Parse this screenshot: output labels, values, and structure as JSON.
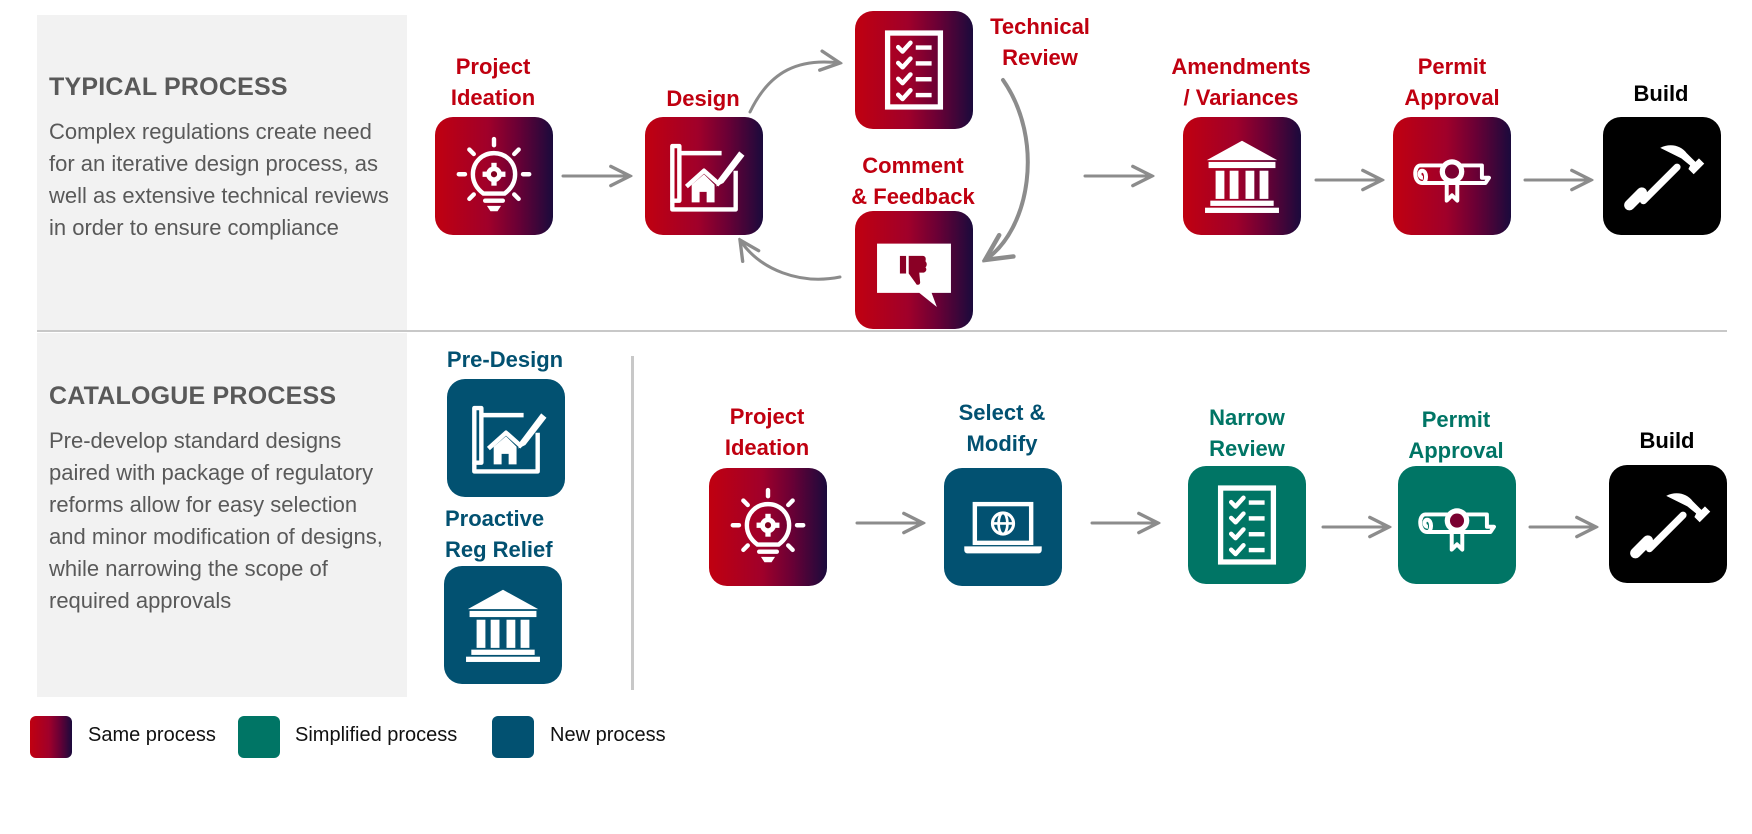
{
  "typical": {
    "title": "TYPICAL PROCESS",
    "description": "Complex regulations create need for an iterative design process, as well as extensive technical reviews in order to ensure compliance",
    "steps": [
      {
        "label_1": "Project",
        "label_2": "Ideation",
        "icon": "lightbulb-gear-icon",
        "category": "same"
      },
      {
        "label_1": "Design",
        "icon": "blueprint-house-icon",
        "category": "same"
      },
      {
        "label_1": "Technical",
        "label_2": "Review",
        "icon": "checklist-icon",
        "category": "same"
      },
      {
        "label_1": "Comment",
        "label_2": "& Feedback",
        "icon": "thumbs-down-comment-icon",
        "category": "same"
      },
      {
        "label_1": "Amendments",
        "label_2": "/ Variances",
        "icon": "government-building-icon",
        "category": "same"
      },
      {
        "label_1": "Permit",
        "label_2": "Approval",
        "icon": "diploma-certificate-icon",
        "category": "same"
      },
      {
        "label_1": "Build",
        "icon": "hammer-icon",
        "category": "build"
      }
    ]
  },
  "catalogue": {
    "title": "CATALOGUE  PROCESS",
    "description": "Pre-develop standard designs paired with package of regulatory reforms allow for easy selection and minor modification of designs, while narrowing the scope of required approvals",
    "pre_steps": [
      {
        "label_1": "Pre-Design",
        "icon": "blueprint-house-icon",
        "category": "new"
      },
      {
        "label_1": "Proactive",
        "label_2": "Reg Relief",
        "icon": "government-building-icon",
        "category": "new"
      }
    ],
    "steps": [
      {
        "label_1": "Project",
        "label_2": "Ideation",
        "icon": "lightbulb-gear-icon",
        "category": "same"
      },
      {
        "label_1": "Select &",
        "label_2": "Modify",
        "icon": "laptop-globe-icon",
        "category": "new"
      },
      {
        "label_1": "Narrow",
        "label_2": "Review",
        "icon": "checklist-icon",
        "category": "simplified"
      },
      {
        "label_1": "Permit",
        "label_2": "Approval",
        "icon": "diploma-certificate-icon",
        "category": "simplified"
      },
      {
        "label_1": "Build",
        "icon": "hammer-icon",
        "category": "build"
      }
    ]
  },
  "legend": [
    {
      "label": "Same process",
      "color_start": "#c00010",
      "color_end": "#1a0a3c"
    },
    {
      "label": "Simplified process",
      "color": "#007565"
    },
    {
      "label": "New process",
      "color": "#025171"
    }
  ],
  "colors": {
    "same_label": "#c00010",
    "simplified": "#007565",
    "new": "#025171",
    "build": "#000000",
    "arrow": "#8c8c8c"
  }
}
